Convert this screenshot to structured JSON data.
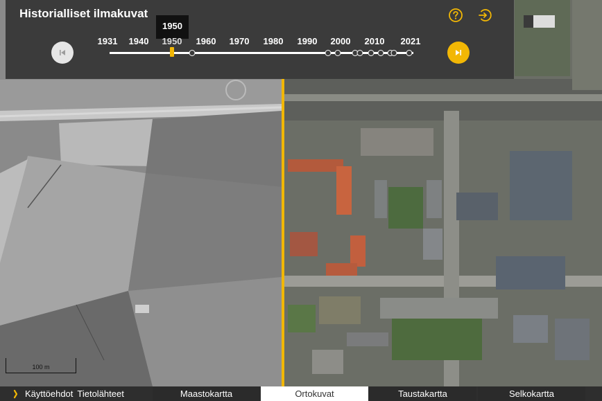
{
  "panel": {
    "title": "Historialliset ilmakuvat",
    "tooltip": "1950",
    "years": [
      "1931",
      "1940",
      "1950",
      "1960",
      "1970",
      "1980",
      "1990",
      "2000",
      "2010",
      "2021"
    ],
    "selected_year": "1950",
    "icons": {
      "help": "help-circle-icon",
      "exit": "exit-icon",
      "prev": "skip-previous-icon",
      "next": "skip-next-icon"
    }
  },
  "map": {
    "scale_label": "100 m"
  },
  "footer": {
    "links": [
      "Käyttöehdot",
      "Tietolähteet"
    ],
    "tabs": [
      {
        "label": "Maastokartta",
        "active": false
      },
      {
        "label": "Ortokuvat",
        "active": true
      },
      {
        "label": "Taustakartta",
        "active": false
      },
      {
        "label": "Selkokartta",
        "active": false
      }
    ]
  },
  "colors": {
    "accent": "#f2b705",
    "panel_bg": "#3b3b3b",
    "footer_bg": "#2e2e2e"
  }
}
